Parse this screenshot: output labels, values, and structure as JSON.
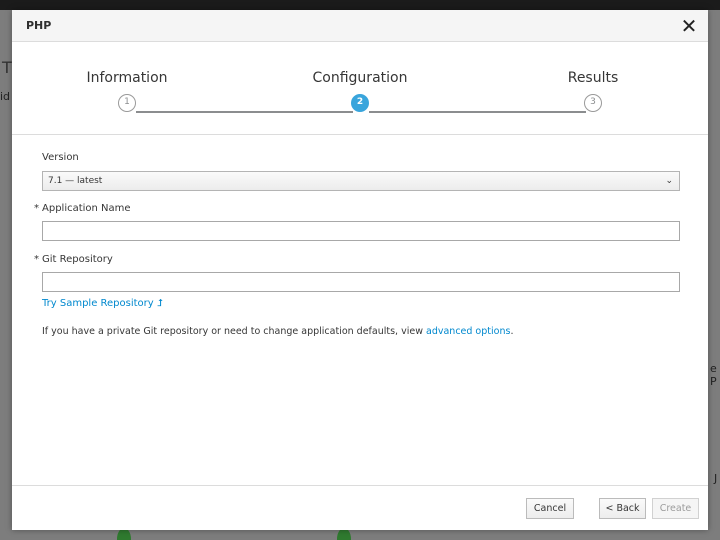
{
  "background": {
    "fragment_1": "T",
    "fragment_2": "id",
    "fragment_3": "e P",
    "fragment_4": "J"
  },
  "modal": {
    "title": "PHP",
    "close_glyph": "✕"
  },
  "wizard": {
    "steps": [
      {
        "label": "Information",
        "number": "1"
      },
      {
        "label": "Configuration",
        "number": "2"
      },
      {
        "label": "Results",
        "number": "3"
      }
    ],
    "active_step": 2
  },
  "form": {
    "version_label": "Version",
    "version_value": "7.1 — latest",
    "version_chevron": "⌄",
    "app_name_required": "*",
    "app_name_label": "Application Name",
    "app_name_value": "",
    "git_repo_required": "*",
    "git_repo_label": "Git Repository",
    "git_repo_value": "",
    "sample_link": "Try Sample Repository ⮥",
    "help_prefix": "If you have a private Git repository or need to change application defaults, view ",
    "help_link": "advanced options",
    "help_suffix": "."
  },
  "footer": {
    "cancel_label": "Cancel",
    "back_label": "< Back",
    "create_label": "Create"
  },
  "colors": {
    "accent": "#39a5dc",
    "link": "#0088ce"
  }
}
